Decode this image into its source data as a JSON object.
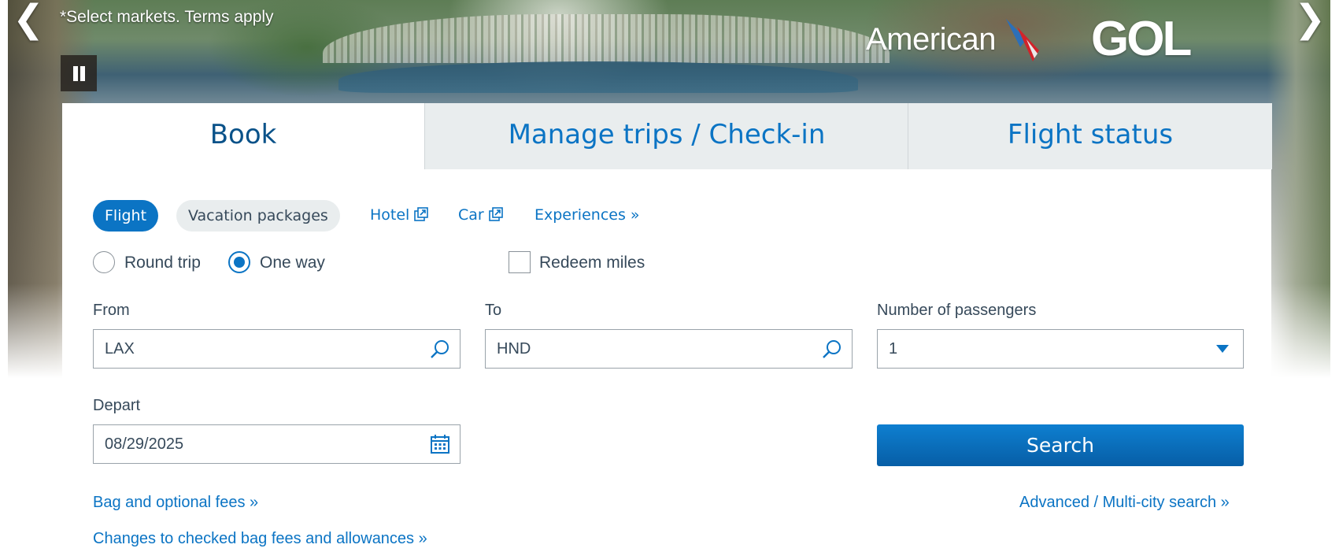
{
  "hero": {
    "caption": "*Select markets. Terms apply",
    "prev_glyph": "❮",
    "next_glyph": "❯",
    "brand_american": "American",
    "brand_gol": "GOL",
    "pause_icon": "pause-icon"
  },
  "tabs": [
    {
      "label": "Book",
      "active": true
    },
    {
      "label": "Manage trips / Check-in",
      "active": false
    },
    {
      "label": "Flight status",
      "active": false
    }
  ],
  "product": {
    "flight": "Flight",
    "vacation": "Vacation packages",
    "hotel": "Hotel",
    "car": "Car",
    "experiences": "Experiences  »"
  },
  "trip_type": {
    "round_trip": "Round trip",
    "one_way": "One way",
    "selected": "One way",
    "redeem_miles": "Redeem miles",
    "redeem_checked": false
  },
  "fields": {
    "from_label": "From",
    "from_value": "LAX",
    "to_label": "To",
    "to_value": "HND",
    "passengers_label": "Number of passengers",
    "passengers_value": "1",
    "depart_label": "Depart",
    "depart_value": "08/29/2025"
  },
  "actions": {
    "search": "Search",
    "bag_fees": "Bag and optional fees »",
    "advanced": "Advanced / Multi-city search »",
    "changes": "Changes to checked bag fees and allowances »"
  },
  "colors": {
    "accent": "#0b74c4",
    "tab_inactive_bg": "#e9edee",
    "text": "#36495a"
  }
}
